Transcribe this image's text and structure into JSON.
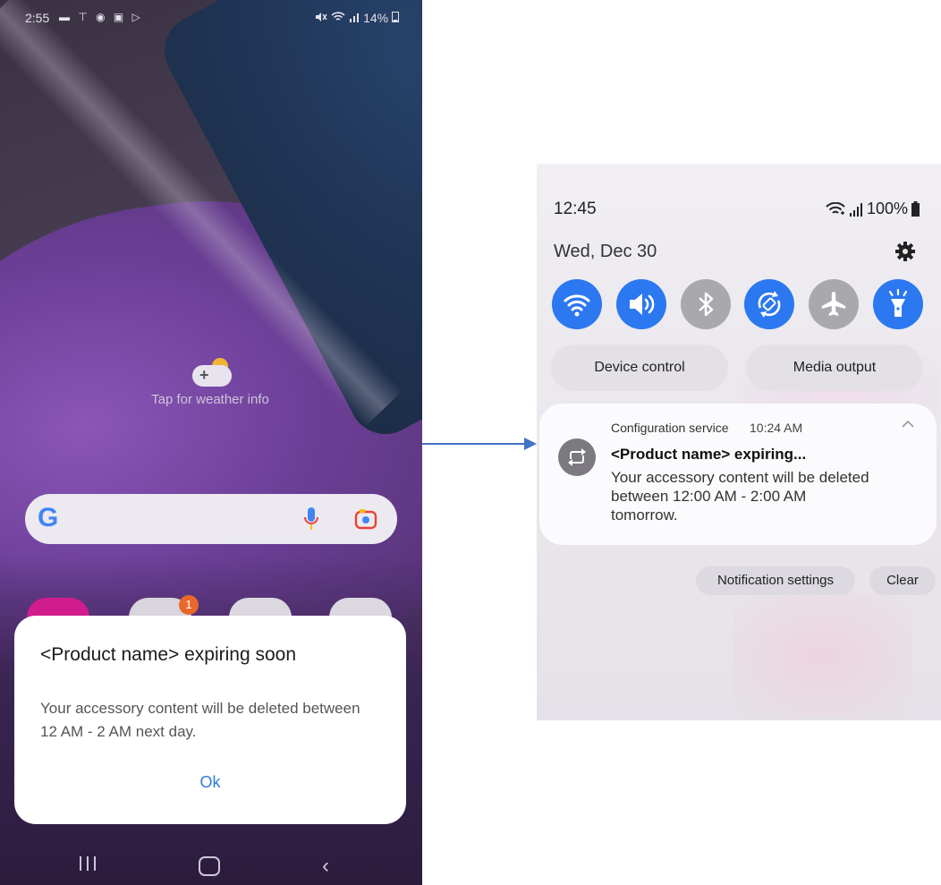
{
  "left_screen": {
    "status": {
      "time": "2:55",
      "left_icons": "▬ ⊤ ◉ ▣ ▷",
      "right_text": "14%",
      "icons": [
        "mute-icon",
        "wifi-icon",
        "signal-icon",
        "battery-icon"
      ]
    },
    "weather": {
      "text": "Tap for weather info"
    },
    "search": {
      "icons": [
        "google-logo",
        "mic-icon",
        "lens-icon"
      ]
    },
    "badge_count": "1",
    "dialog": {
      "title": "<Product name> expiring soon",
      "body": "Your accessory content will be deleted between 12 AM - 2 AM next day.",
      "ok_label": "Ok"
    },
    "nav": {
      "icons": [
        "recents-icon",
        "home-icon",
        "back-icon"
      ]
    }
  },
  "right_screen": {
    "status": {
      "time": "12:45",
      "battery": "100%",
      "icons": [
        "wifi-icon",
        "signal-icon",
        "battery-icon"
      ]
    },
    "date": "Wed, Dec 30",
    "quick_settings": [
      {
        "name": "wifi",
        "state": "on"
      },
      {
        "name": "sound",
        "state": "on"
      },
      {
        "name": "bluetooth",
        "state": "off"
      },
      {
        "name": "auto-rotate",
        "state": "on"
      },
      {
        "name": "airplane-mode",
        "state": "off"
      },
      {
        "name": "flashlight",
        "state": "on"
      }
    ],
    "device_control_label": "Device control",
    "media_output_label": "Media output",
    "notification": {
      "app": "Configuration service",
      "time": "10:24 AM",
      "title": "<Product name> expiring...",
      "body": "Your accessory content will be deleted between 12:00 AM - 2:00 AM tomorrow."
    },
    "notification_settings_label": "Notification settings",
    "clear_label": "Clear"
  },
  "colors": {
    "accent_blue": "#2b78f0",
    "toggle_off": "#a9a8ad",
    "dialog_ok": "#2f7ad8",
    "arrow": "#4472c4"
  }
}
